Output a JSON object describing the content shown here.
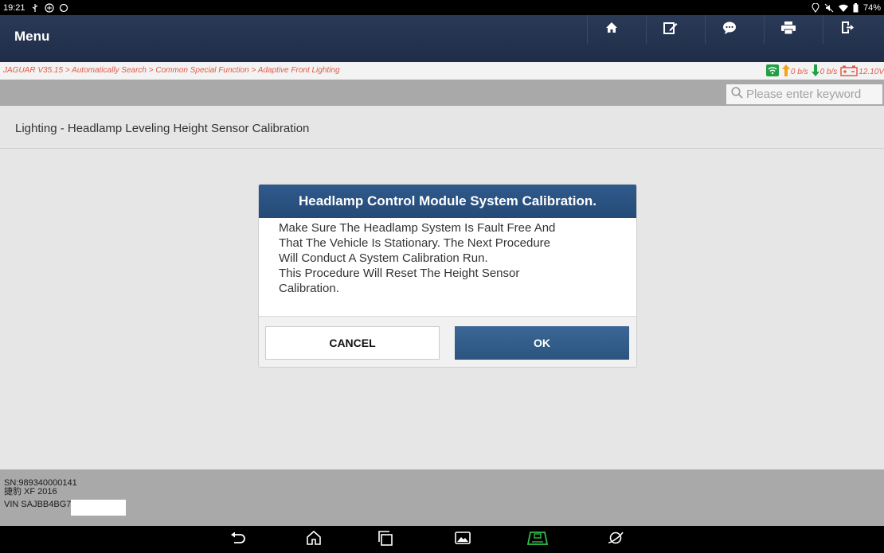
{
  "status_bar": {
    "time": "19:21",
    "battery": "74%"
  },
  "menubar": {
    "title": "Menu",
    "tools": [
      "home-icon",
      "edit-icon",
      "chat-icon",
      "print-icon",
      "exit-icon"
    ]
  },
  "breadcrumb": {
    "path": "JAGUAR V35.15 > Automatically Search > Common Special Function > Adaptive Front Lighting",
    "upload_rate": "0 b/s",
    "download_rate": "0 b/s",
    "voltage": "12.10V"
  },
  "search": {
    "placeholder": "Please enter keyword"
  },
  "section": {
    "title": "Lighting - Headlamp Leveling Height Sensor Calibration"
  },
  "dialog": {
    "title": "Headlamp Control Module System Calibration.",
    "line1": "Make Sure The Headlamp System Is Fault Free And",
    "line2": "That The Vehicle Is Stationary. The Next Procedure",
    "line3": "Will Conduct A System Calibration Run.",
    "line4": "This Procedure Will Reset The Height Sensor",
    "line5": "Calibration.",
    "cancel_label": "CANCEL",
    "ok_label": "OK"
  },
  "footer": {
    "sn": "SN:989340000141",
    "model": "捷豹 XF 2016",
    "vin": "VIN SAJBB4BG7"
  },
  "colors": {
    "menubar": "#1f2d47",
    "breadcrumb_text": "#e05a47",
    "dialog_header": "#2f5a8c",
    "ok_button": "#2b557f"
  }
}
